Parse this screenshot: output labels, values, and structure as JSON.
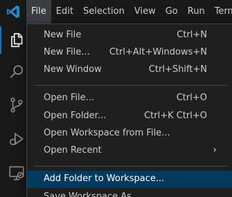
{
  "menubar": {
    "items": [
      {
        "label": "File",
        "active": true
      },
      {
        "label": "Edit"
      },
      {
        "label": "Selection"
      },
      {
        "label": "View"
      },
      {
        "label": "Go"
      },
      {
        "label": "Run"
      },
      {
        "label": "Termi"
      }
    ]
  },
  "activitybar": {
    "icons": [
      "explorer-icon",
      "search-icon",
      "source-control-icon",
      "run-debug-icon",
      "remote-explorer-icon"
    ]
  },
  "file_menu": {
    "new_file": {
      "label": "New File",
      "shortcut": "Ctrl+N"
    },
    "new_file_dots": {
      "label": "New File...",
      "shortcut": "Ctrl+Alt+Windows+N"
    },
    "new_window": {
      "label": "New Window",
      "shortcut": "Ctrl+Shift+N"
    },
    "open_file": {
      "label": "Open File...",
      "shortcut": "Ctrl+O"
    },
    "open_folder": {
      "label": "Open Folder...",
      "shortcut": "Ctrl+K Ctrl+O"
    },
    "open_workspace": {
      "label": "Open Workspace from File..."
    },
    "open_recent": {
      "label": "Open Recent",
      "submenu_glyph": "›"
    },
    "add_folder": {
      "label": "Add Folder to Workspace..."
    },
    "save_workspace_as": {
      "label": "Save Workspace As..."
    }
  },
  "colors": {
    "accent": "#0078d4",
    "highlight": "#04395e",
    "menu_bg": "#1f1f1f",
    "logo": "#2489ca"
  }
}
